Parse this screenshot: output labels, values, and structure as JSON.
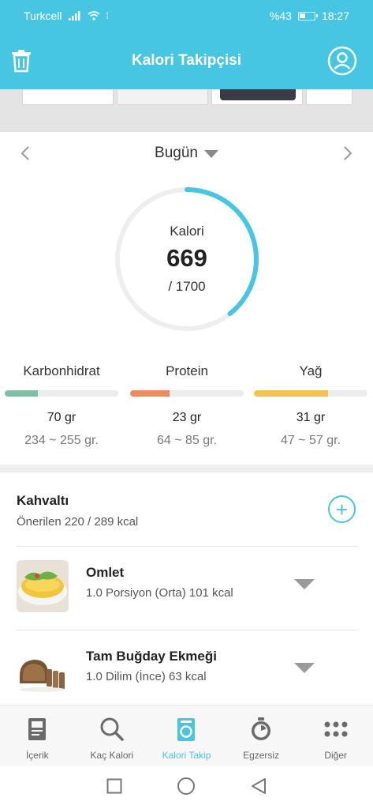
{
  "status_bar": {
    "carrier": "Turkcell",
    "battery": "%43",
    "time": "18:27"
  },
  "header": {
    "title": "Kalori Takipçisi",
    "icons": {
      "left": "trash-icon",
      "right": "profile-icon"
    }
  },
  "date_nav": {
    "label": "Bugün"
  },
  "calories": {
    "label": "Kalori",
    "value": "669",
    "goal": "/ 1700",
    "progress_fraction": 0.3935
  },
  "macros": [
    {
      "name": "Karbonhidrat",
      "grams": "70 gr",
      "range": "234 ~ 255 gr.",
      "progress_fraction": 0.29,
      "color": "#7fbfa5"
    },
    {
      "name": "Protein",
      "grams": "23 gr",
      "range": "64 ~ 85 gr.",
      "progress_fraction": 0.35,
      "color": "#f08a5d"
    },
    {
      "name": "Yağ",
      "grams": "31 gr",
      "range": "47 ~ 57 gr.",
      "progress_fraction": 0.65,
      "color": "#f5c24c"
    }
  ],
  "meal": {
    "title": "Kahvaltı",
    "subtitle": "Önerilen 220 / 289 kcal",
    "foods": [
      {
        "name": "Omlet",
        "detail": "1.0 Porsiyon (Orta) 101 kcal"
      },
      {
        "name": "Tam Buğday Ekmeği",
        "detail": "1.0 Dilim (İnce) 63 kcal"
      }
    ]
  },
  "tabs": [
    {
      "label": "İçerik",
      "icon": "book-icon",
      "active": false
    },
    {
      "label": "Kaç Kalori",
      "icon": "search-icon",
      "active": false
    },
    {
      "label": "Kalori Takip",
      "icon": "scale-icon",
      "active": true
    },
    {
      "label": "Egzersiz",
      "icon": "stopwatch-icon",
      "active": false
    },
    {
      "label": "Diğer",
      "icon": "grid-dots-icon",
      "active": false
    }
  ],
  "colors": {
    "accent": "#46c6e3",
    "ring_track": "#eeeeee"
  }
}
